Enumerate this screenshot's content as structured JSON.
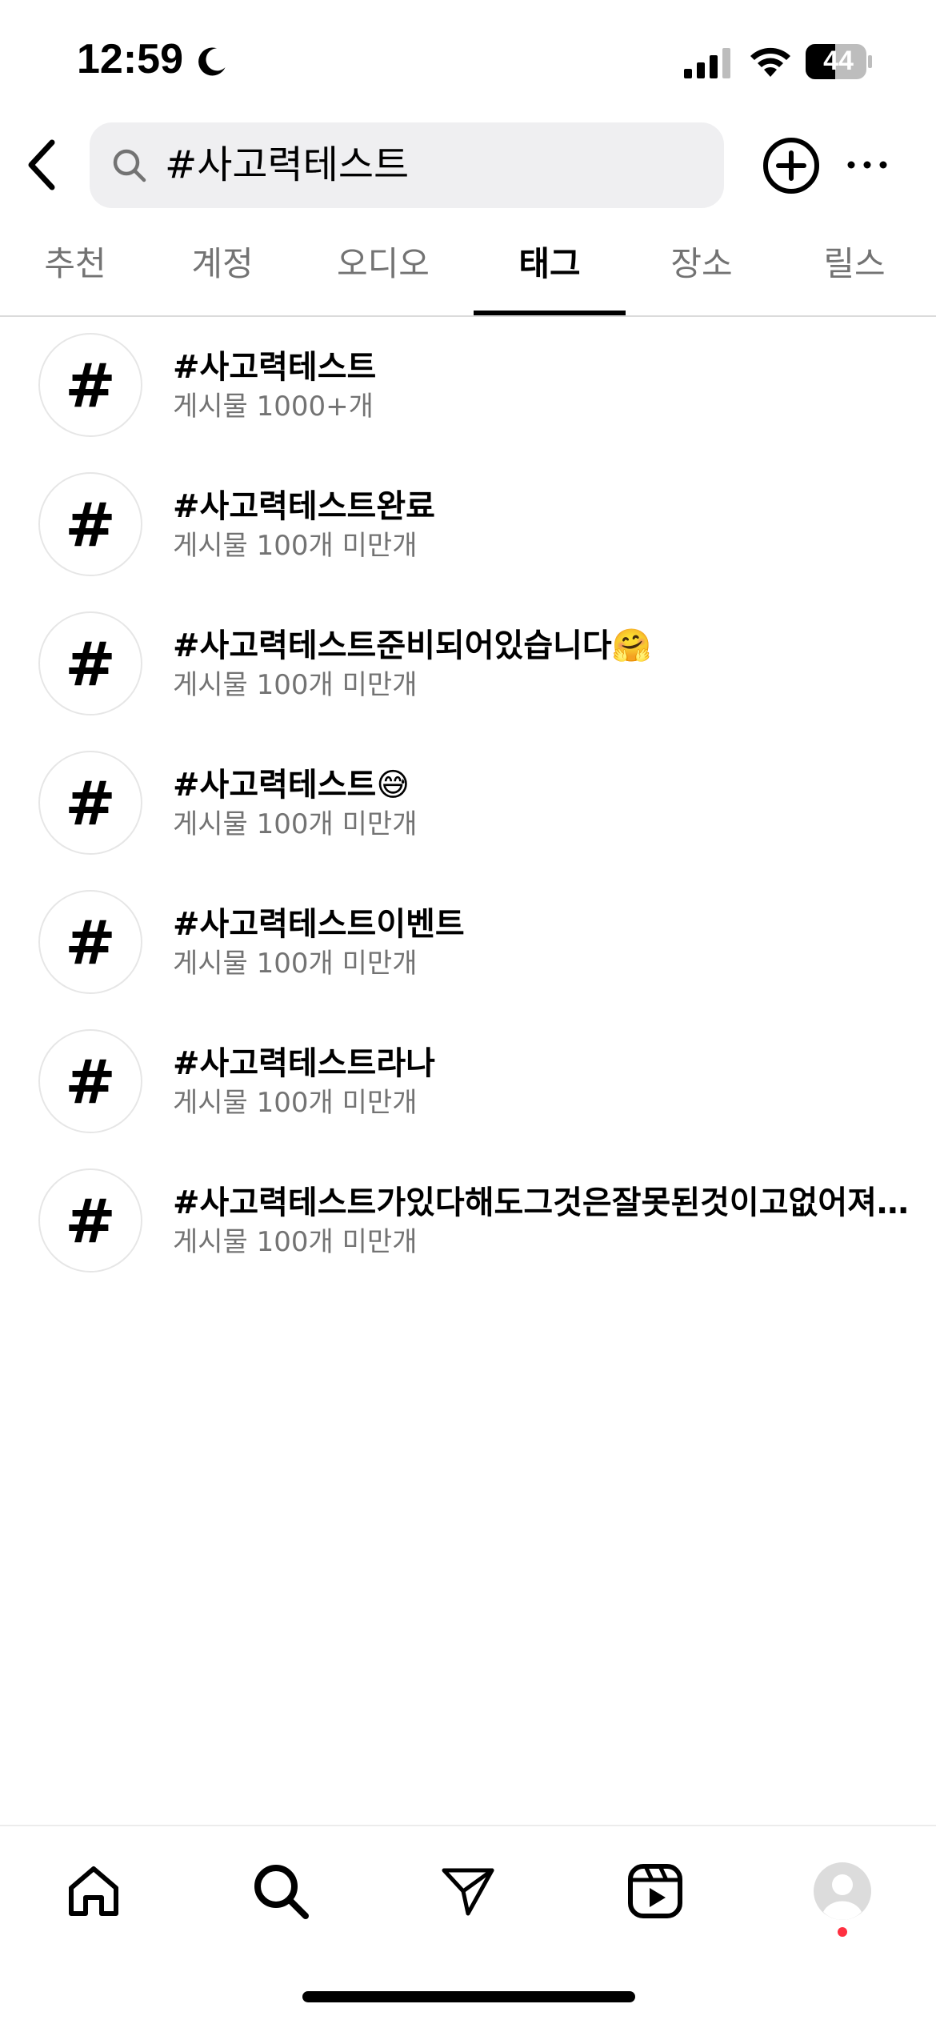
{
  "status_bar": {
    "time": "12:59",
    "battery": "44"
  },
  "search": {
    "query": "#사고력테스트"
  },
  "tabs": [
    {
      "label": "추천",
      "active": false
    },
    {
      "label": "계정",
      "active": false
    },
    {
      "label": "오디오",
      "active": false
    },
    {
      "label": "태그",
      "active": true
    },
    {
      "label": "장소",
      "active": false
    },
    {
      "label": "릴스",
      "active": false
    }
  ],
  "tags": [
    {
      "name": "#사고력테스트",
      "count": "게시물 1000+개"
    },
    {
      "name": "#사고력테스트완료",
      "count": "게시물 100개 미만개"
    },
    {
      "name": "#사고력테스트준비되어있습니다🤗",
      "count": "게시물 100개 미만개"
    },
    {
      "name": "#사고력테스트😅",
      "count": "게시물 100개 미만개"
    },
    {
      "name": "#사고력테스트이벤트",
      "count": "게시물 100개 미만개"
    },
    {
      "name": "#사고력테스트라나",
      "count": "게시물 100개 미만개"
    },
    {
      "name": "#사고력테스트가있다해도그것은잘못된것이고없어져야할것이다",
      "count": "게시물 100개 미만개"
    }
  ],
  "hash_symbol": "#",
  "bottom_nav": [
    {
      "icon": "home-icon"
    },
    {
      "icon": "search-icon"
    },
    {
      "icon": "send-icon"
    },
    {
      "icon": "reels-icon"
    },
    {
      "icon": "profile-avatar-icon"
    }
  ],
  "colors": {
    "secondary_text": "#737373",
    "search_bg": "#efeff1",
    "notification_dot": "#ff3040"
  }
}
